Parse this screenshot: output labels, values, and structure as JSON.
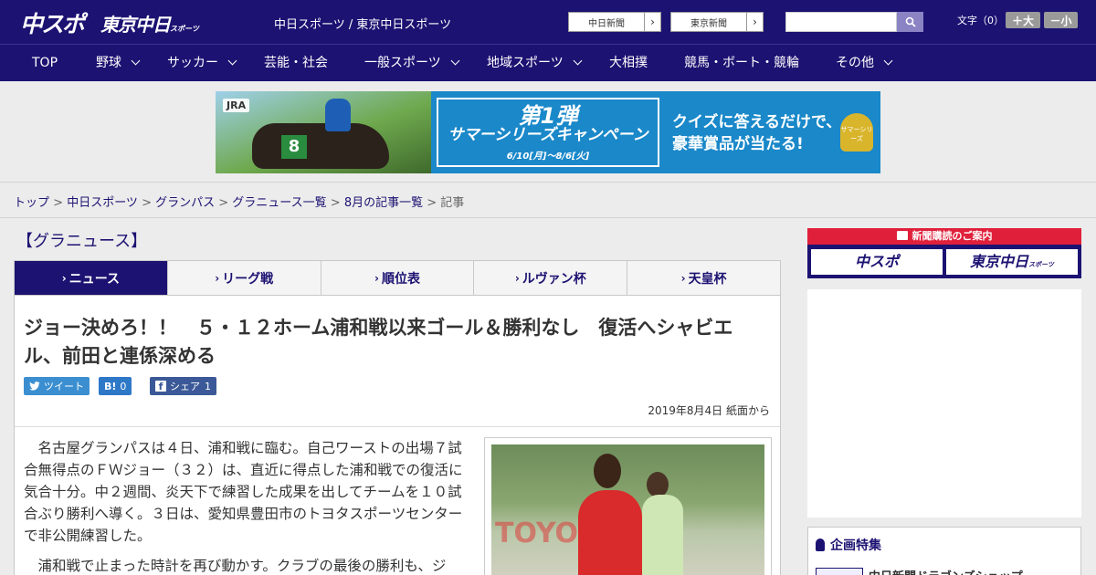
{
  "header": {
    "logo_chuspo": "中スポ",
    "logo_tokyo": "東京中日",
    "logo_tokyo_suffix": "スポーツ",
    "site_names": "中日スポーツ / 東京中日スポーツ",
    "links": [
      {
        "label": "中日新聞"
      },
      {
        "label": "東京新聞"
      }
    ],
    "search_placeholder": "",
    "fontsize": {
      "label": "文字（0）",
      "bigger": "＋大",
      "smaller": "－小"
    }
  },
  "nav": {
    "items": [
      {
        "label": "TOP"
      },
      {
        "label": "野球"
      },
      {
        "label": "サッカー"
      },
      {
        "label": "芸能・社会"
      },
      {
        "label": "一般スポーツ"
      },
      {
        "label": "地域スポーツ"
      },
      {
        "label": "大相撲"
      },
      {
        "label": "競馬・ボート・競輪"
      },
      {
        "label": "その他"
      }
    ]
  },
  "banner": {
    "brand": "JRA",
    "number": "8",
    "campaign_big": "第1弾",
    "campaign_title": "サマーシリーズキャンペーン",
    "campaign_dates": "6/10[月]～8/6[火]",
    "quiz_line1": "クイズに答えるだけで、",
    "quiz_line2": "豪華賞品が当たる!",
    "cup_text": "サマーシリーズ"
  },
  "breadcrumb": {
    "items": [
      {
        "label": "トップ"
      },
      {
        "label": "中日スポーツ"
      },
      {
        "label": "グランパス"
      },
      {
        "label": "グラニュース一覧"
      },
      {
        "label": "8月の記事一覧"
      }
    ],
    "current": "記事",
    "separator": " > "
  },
  "section_title": "【グラニュース】",
  "tabs": [
    {
      "label": "ニュース",
      "active": true
    },
    {
      "label": "リーグ戦"
    },
    {
      "label": "順位表"
    },
    {
      "label": "ルヴァン杯"
    },
    {
      "label": "天皇杯"
    }
  ],
  "article": {
    "headline": "ジョー決めろ！！　５・１２ホーム浦和戦以来ゴール＆勝利なし　復活へシャビエル、前田と連係深める",
    "share": {
      "tweet": "ツイート",
      "hatena_icon": "B!",
      "hatena_count": "0",
      "fb": "シェア",
      "fb_count": "1"
    },
    "date": "2019年8月4日 紙面から",
    "para1": "名古屋グランパスは４日、浦和戦に臨む。自己ワーストの出場７試合無得点のＦＷジョー（３２）は、直近に得点した浦和戦での復活に気合十分。中２週間、炎天下で練習した成果を出してチームを１０試合ぶり勝利へ導く。３日は、愛知県豊田市のトヨタスポーツセンターで非公開練習した。",
    "para2": "浦和戦で止まった時計を再び動かす。クラブの最後の勝利も、ジ",
    "photo_sign": "TOYO"
  },
  "sidebar": {
    "subscribe_header": "新聞購読のご案内",
    "subscribe_chuspo": "中スポ",
    "subscribe_tokyo": "東京中日",
    "subscribe_tokyo_suffix": "スポーツ",
    "feature_title": "企画特集",
    "feature_item": "中日新聞ドラゴンズショップ"
  },
  "colors": {
    "brand_navy": "#1c1272",
    "subscribe_red": "#e0203a",
    "twitter": "#3b8fd1",
    "facebook": "#3b5998"
  }
}
